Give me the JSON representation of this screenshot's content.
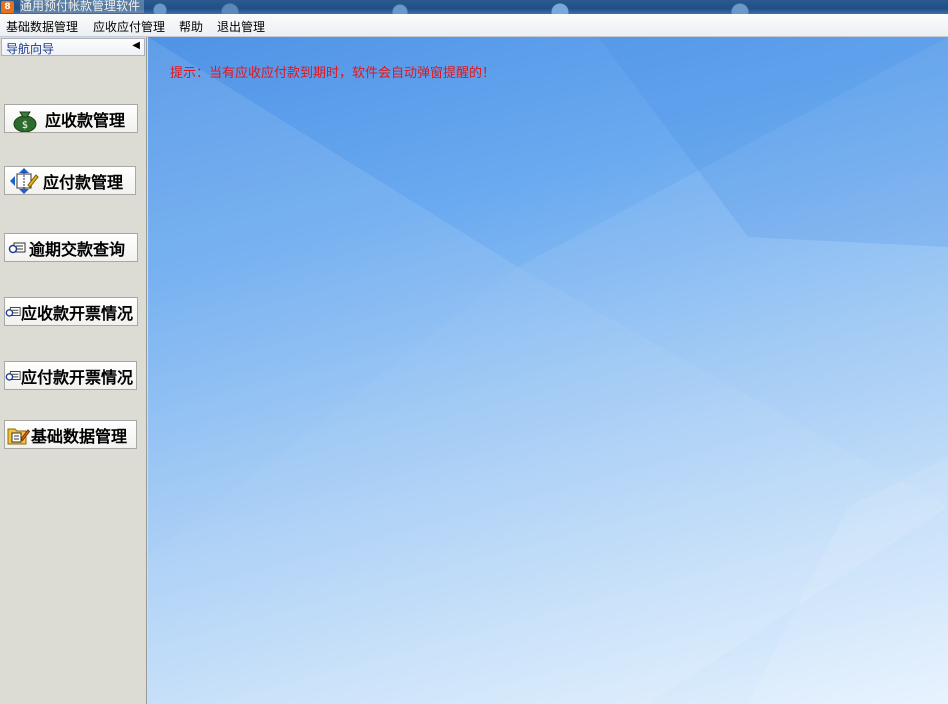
{
  "window": {
    "title": "通用预付帐款管理软件",
    "icon_glyph": "8"
  },
  "menu": [
    {
      "label": "基础数据管理"
    },
    {
      "label": "应收应付管理"
    },
    {
      "label": "帮助"
    },
    {
      "label": "退出管理"
    }
  ],
  "nav": {
    "header": "导航向导",
    "collapse_glyph": "◀",
    "buttons": [
      {
        "label": "应收款管理",
        "icon": "money-bag-icon"
      },
      {
        "label": "应付款管理",
        "icon": "payment-edit-icon"
      },
      {
        "label": "逾期交款查询",
        "icon": "query-icon"
      },
      {
        "label": "应收款开票情况",
        "icon": "query-icon"
      },
      {
        "label": "应付款开票情况",
        "icon": "query-icon"
      },
      {
        "label": "基础数据管理",
        "icon": "folder-edit-icon"
      }
    ]
  },
  "main": {
    "hint": "提示：当有应收应付款到期时，软件会自动弹窗提醒的！"
  },
  "colors": {
    "hint_text": "#e4151a",
    "nav_header_text": "#1a3c8c"
  }
}
